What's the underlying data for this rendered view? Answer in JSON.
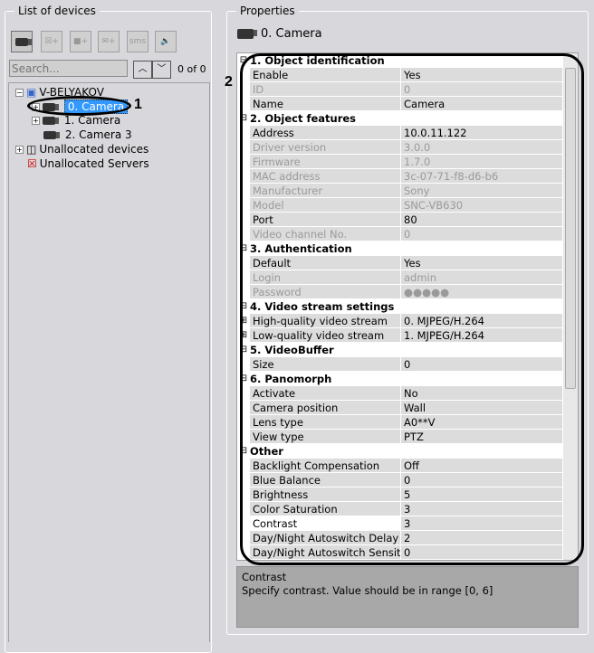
{
  "left_panel": {
    "title": "List of devices",
    "toolbar": [
      {
        "icon": "camera-search-icon",
        "label": ""
      },
      {
        "icon": "add-monitor-icon",
        "label": ""
      },
      {
        "icon": "add-camera-icon",
        "label": ""
      },
      {
        "icon": "add-mail-icon",
        "label": ""
      },
      {
        "icon": "add-sms-icon",
        "label": "sms"
      },
      {
        "icon": "add-speaker-icon",
        "label": ""
      }
    ],
    "search_placeholder": "Search...",
    "match_count": "0 of 0",
    "up": "^",
    "down": "v",
    "tree": {
      "root": "V-BELYAKOV",
      "cameras": [
        "0. Camera",
        "1. Camera",
        "2. Camera 3"
      ],
      "unallocated_devices": "Unallocated devices",
      "unallocated_servers": "Unallocated Servers"
    }
  },
  "right_panel": {
    "title": "Properties",
    "object_title": "0. Camera",
    "rows": [
      {
        "g": "1. Object identification"
      },
      {
        "n": "Enable",
        "v": "Yes"
      },
      {
        "n": "ID",
        "v": "0",
        "d": true
      },
      {
        "n": "Name",
        "v": "Camera"
      },
      {
        "g": "2. Object features"
      },
      {
        "n": "Address",
        "v": "10.0.11.122"
      },
      {
        "n": "Driver version",
        "v": "3.0.0",
        "d": true
      },
      {
        "n": "Firmware",
        "v": "1.7.0",
        "d": true
      },
      {
        "n": "MAC address",
        "v": "3c-07-71-f8-d6-b6",
        "d": true
      },
      {
        "n": "Manufacturer",
        "v": "Sony",
        "d": true
      },
      {
        "n": "Model",
        "v": "SNC-VB630",
        "d": true
      },
      {
        "n": "Port",
        "v": "80"
      },
      {
        "n": "Video channel No.",
        "v": "0",
        "d": true
      },
      {
        "g": "3. Authentication"
      },
      {
        "n": "Default",
        "v": "Yes"
      },
      {
        "n": "Login",
        "v": "admin",
        "d": true
      },
      {
        "n": "Password",
        "v": "●●●●●",
        "d": true
      },
      {
        "g": "4. Video stream settings"
      },
      {
        "n": "High-quality video stream",
        "v": "0. MJPEG/H.264",
        "e": true
      },
      {
        "n": "Low-quality video stream",
        "v": "1. MJPEG/H.264",
        "e": true
      },
      {
        "g": "5. VideoBuffer"
      },
      {
        "n": "Size",
        "v": "0"
      },
      {
        "g": "6. Panomorph"
      },
      {
        "n": "Activate",
        "v": "No"
      },
      {
        "n": "Camera position",
        "v": "Wall"
      },
      {
        "n": "Lens type",
        "v": "A0**V"
      },
      {
        "n": "View type",
        "v": "PTZ"
      },
      {
        "g": "Other"
      },
      {
        "n": "Backlight Compensation",
        "v": "Off"
      },
      {
        "n": "Blue Balance",
        "v": "0"
      },
      {
        "n": "Brightness",
        "v": "5"
      },
      {
        "n": "Color Saturation",
        "v": "3"
      },
      {
        "n": "Contrast",
        "v": "3",
        "s": true
      },
      {
        "n": "Day/Night Autoswitch Delay",
        "v": "2"
      },
      {
        "n": "Day/Night Autoswitch Sensiti",
        "v": "0"
      }
    ],
    "description": {
      "title": "Contrast",
      "text": "Specify contrast. Value should be in range [0, 6]"
    }
  },
  "callouts": [
    "1",
    "2"
  ]
}
